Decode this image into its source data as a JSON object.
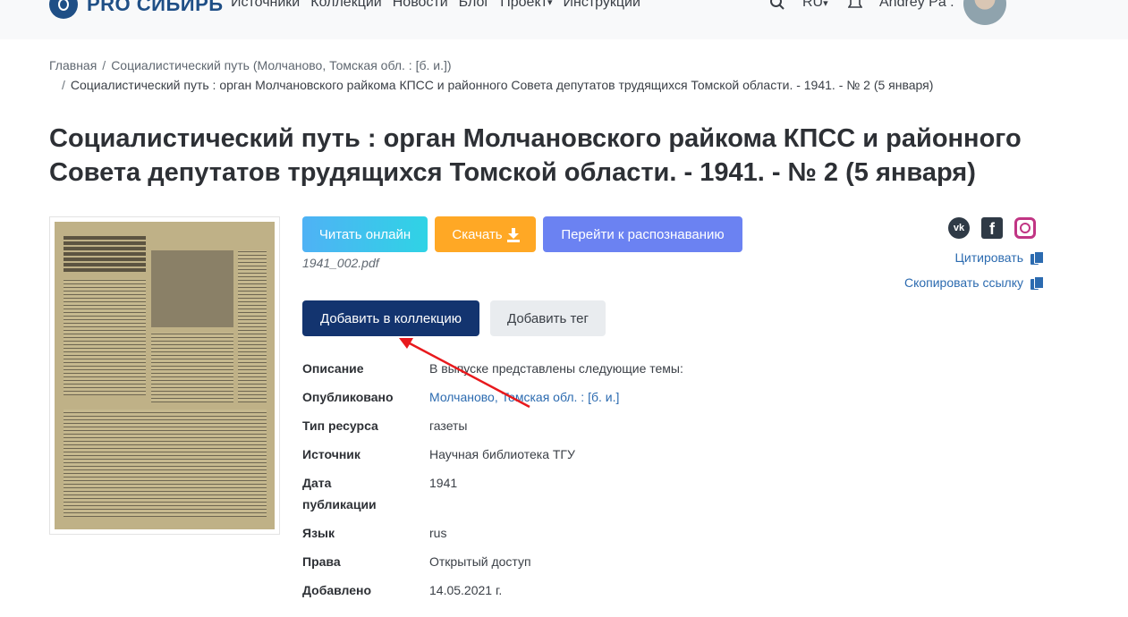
{
  "header": {
    "logo_text": "PRO СИБИРЬ",
    "nav": [
      "Источники",
      "Коллекции",
      "Новости",
      "Блог",
      "Проект",
      "Инструкции"
    ],
    "lang": "RU",
    "user": "Andrey Pa ."
  },
  "breadcrumb": {
    "home": "Главная",
    "parent": "Социалистический путь (Молчаново, Томская обл. : [б. и.])",
    "current": "Социалистический путь : орган Молчановского райкома КПСС и районного Совета депутатов трудящихся Томской области. - 1941. - № 2 (5 января)"
  },
  "title": "Социалистический путь : орган Молчановского райкома КПСС и районного Совета депутатов трудящихся Томской области. - 1941. - № 2 (5 января)",
  "actions": {
    "read_online": "Читать онлайн",
    "download": "Скачать",
    "recognize": "Перейти к распознаванию",
    "filename": "1941_002.pdf",
    "add_to_collection": "Добавить в коллекцию",
    "add_tag": "Добавить тег",
    "cite": "Цитировать",
    "copy_link": "Скопировать ссылку"
  },
  "social": [
    "vk-icon",
    "facebook-icon",
    "instagram-icon"
  ],
  "metadata": [
    {
      "key": "Описание",
      "value": "В выпуске представлены следующие темы:"
    },
    {
      "key": "Опубликовано",
      "value": "Молчаново, Томская обл. : [б. и.]"
    },
    {
      "key": "Тип ресурса",
      "value": "газеты"
    },
    {
      "key": "Источник",
      "value": "Научная библиотека ТГУ"
    },
    {
      "key": "Дата публикации",
      "value": "1941"
    },
    {
      "key": "Язык",
      "value": "rus"
    },
    {
      "key": "Права",
      "value": "Открытый доступ"
    },
    {
      "key": "Добавлено",
      "value": "14.05.2021 г."
    }
  ],
  "colors": {
    "brand": "#1f4f86",
    "read_btn": "#4fb2f5",
    "download_btn": "#ffa825",
    "recognize_btn": "#6b82f2",
    "collection_btn": "#13346f",
    "link": "#2c6bb0",
    "annotation_arrow": "#e8191d"
  }
}
